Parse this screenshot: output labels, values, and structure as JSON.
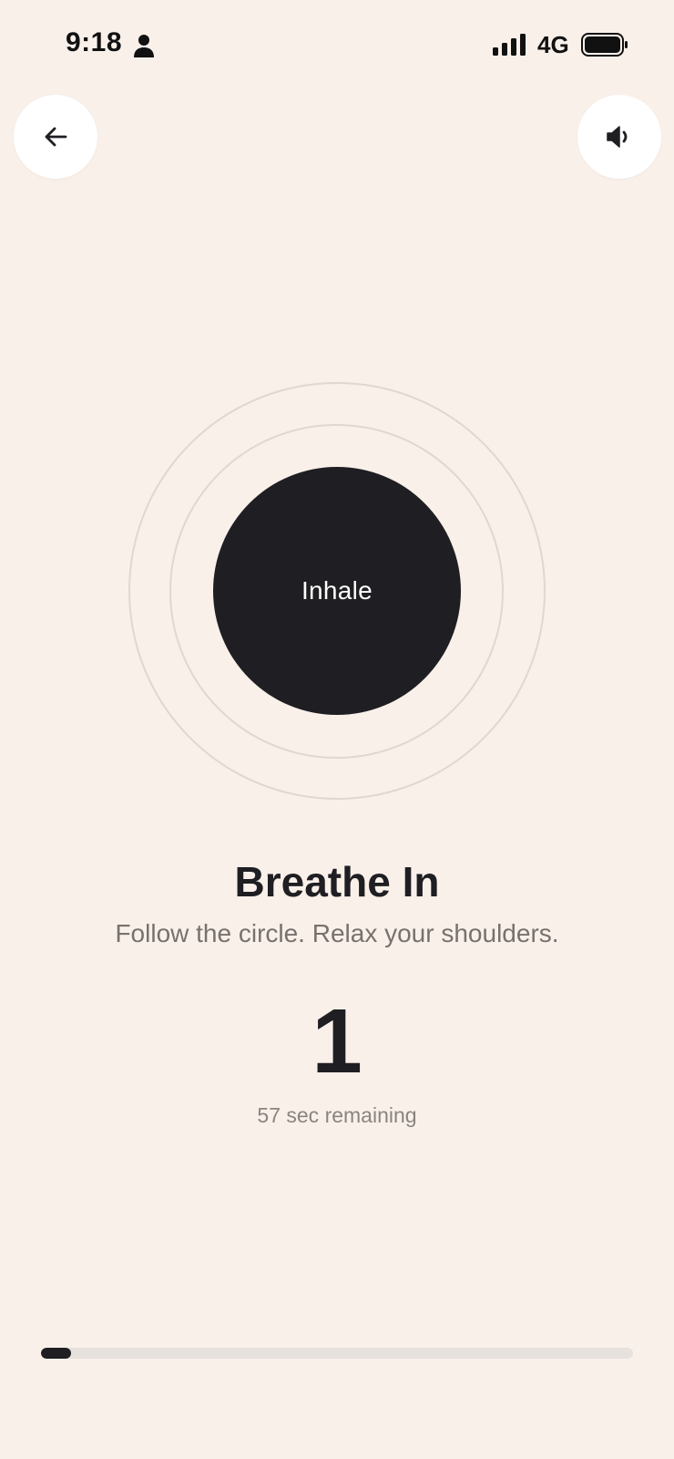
{
  "status_bar": {
    "time": "9:18",
    "network": "4G",
    "icons": {
      "person": "person-icon",
      "signal": "signal-bars-icon",
      "battery": "battery-icon"
    }
  },
  "header": {
    "back_icon": "arrow-left-icon",
    "sound_icon": "speaker-icon"
  },
  "breath": {
    "circle_label": "Inhale",
    "title": "Breathe In",
    "instruction": "Follow the circle. Relax your shoulders.",
    "count": "1",
    "remaining": "57 sec remaining"
  },
  "progress": {
    "fraction": 0.05
  },
  "colors": {
    "background": "#f9f0ea",
    "circle": "#1f1e22",
    "ring": "#e1d7d0",
    "track": "#e7e1dd",
    "muted_text": "#77716d"
  }
}
